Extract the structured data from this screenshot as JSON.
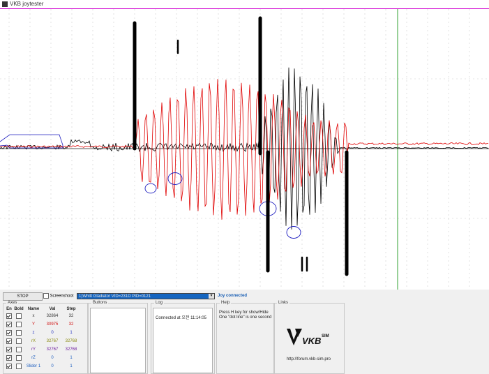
{
  "window": {
    "title": "VKB joytester"
  },
  "toolbar": {
    "stop_label": "STOP",
    "screenshot_label": "Screenshoot",
    "screenshot_checked": false,
    "device_selected": "1)Whitt Gladiator VID=231D PID=0121",
    "status": "Joy connected"
  },
  "axes": {
    "group_label": "Axes",
    "headers": [
      "En",
      "Bold",
      "Name",
      "Val",
      "Step"
    ],
    "rows": [
      {
        "en": true,
        "bold": false,
        "name": "x",
        "val": "32864",
        "step": "32",
        "color": "#333333"
      },
      {
        "en": true,
        "bold": false,
        "name": "Y",
        "val": "30975",
        "step": "32",
        "color": "#d01010"
      },
      {
        "en": true,
        "bold": false,
        "name": "z",
        "val": "0",
        "step": "1",
        "color": "#2030c0"
      },
      {
        "en": true,
        "bold": false,
        "name": "rX",
        "val": "32767",
        "step": "32768",
        "color": "#8a8a10"
      },
      {
        "en": true,
        "bold": false,
        "name": "rY",
        "val": "32767",
        "step": "32768",
        "color": "#7020a0"
      },
      {
        "en": true,
        "bold": false,
        "name": "rZ",
        "val": "0",
        "step": "1",
        "color": "#2060c0"
      },
      {
        "en": true,
        "bold": false,
        "name": "Slider 1",
        "val": "0",
        "step": "1",
        "color": "#2060c0"
      }
    ]
  },
  "buttons_group": {
    "label": "Buttons"
  },
  "log": {
    "label": "Log",
    "entries": [
      "Connected at 오전 11:14:05"
    ]
  },
  "help": {
    "label": "Help",
    "lines": [
      "Press H key for show/Hide",
      "One \"dot line\" is one second"
    ]
  },
  "links": {
    "label": "Links",
    "url": "http://forum.vkb-sim.pro",
    "logo_text": "VKB",
    "logo_super": "SIM"
  },
  "colors": {
    "title_border": "#d000d0",
    "series_red": "#e00000",
    "series_blue": "#2020c0",
    "series_black": "#000000",
    "cursor_green": "#30a030"
  }
}
